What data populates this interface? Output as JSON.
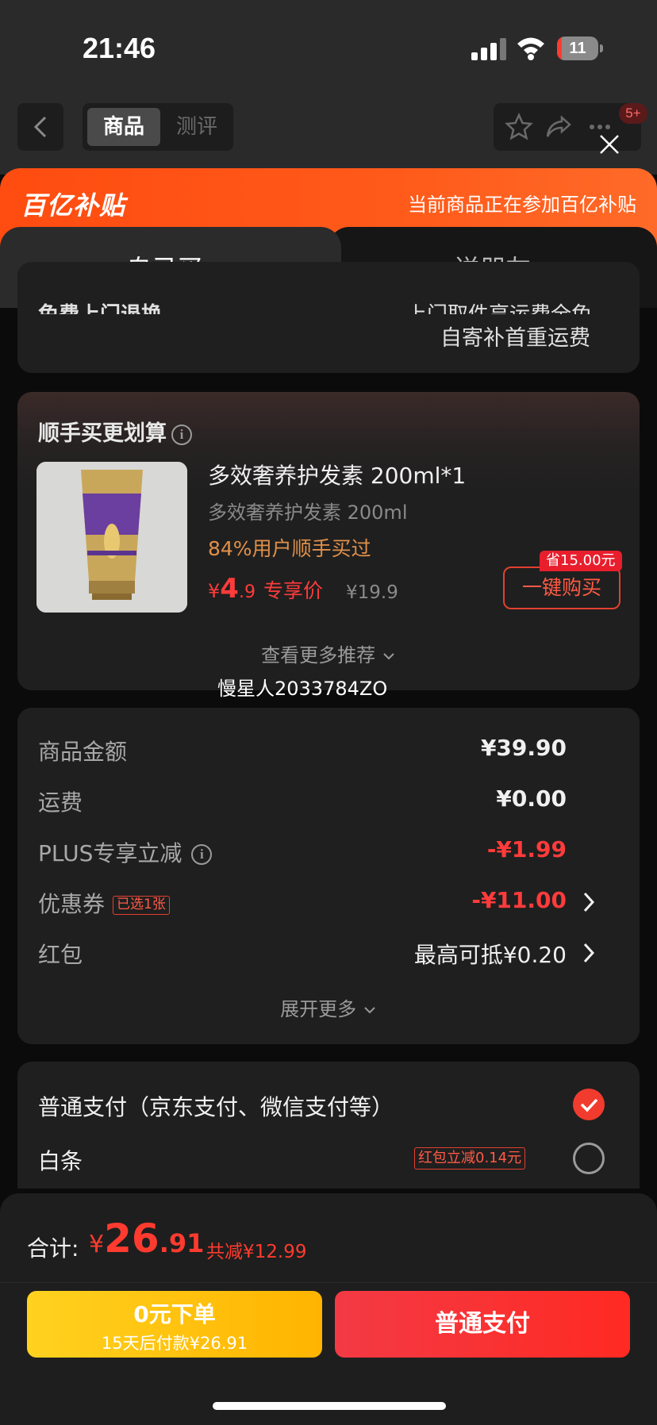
{
  "status_bar": {
    "time": "21:46",
    "battery": "11"
  },
  "header": {
    "tabs": [
      "商品",
      "测评"
    ],
    "badge": "5+"
  },
  "banner": {
    "logo": "百亿补贴",
    "note": "当前商品正在参加百亿补贴"
  },
  "buy_tabs": {
    "self": "自己买",
    "gift": "送朋友"
  },
  "return_card": {
    "left_partial": "免费上门退换",
    "right_partial": "上门取件享运费全免",
    "self_ship": "自寄补首重运费"
  },
  "addon": {
    "title": "顺手买更划算",
    "product_name": "多效奢养护发素 200ml*1",
    "spec": "多效奢养护发素 200ml",
    "bought": "84%用户顺手买过",
    "price_symbol": "¥",
    "price_int": "4",
    "price_dec": ".9",
    "price_tag": "专享价",
    "old_price": "¥19.9",
    "save_tag": "省15.00元",
    "buy_button": "一键购买",
    "more": "查看更多推荐"
  },
  "watermark": "慢星人2033784ZO",
  "costs": {
    "rows": [
      {
        "label": "商品金额",
        "value": "¥39.90"
      },
      {
        "label": "运费",
        "value": "¥0.00"
      },
      {
        "label": "PLUS专享立减",
        "value": "-¥1.99"
      },
      {
        "label": "优惠券",
        "tag": "已选1张",
        "value": "-¥11.00"
      },
      {
        "label": "红包",
        "value": "最高可抵¥0.20"
      }
    ],
    "expand": "展开更多"
  },
  "payment": {
    "normal": "普通支付（京东支付、微信支付等）",
    "baitiao": "白条",
    "baitiao_tag": "红包立减0.14元"
  },
  "total": {
    "label": "合计:",
    "symbol": "¥",
    "int": "26",
    "dec": ".91",
    "cut": "共减¥12.99"
  },
  "actions": {
    "zero_line1": "0元下单",
    "zero_line2": "15天后付款¥26.91",
    "pay": "普通支付"
  },
  "colors": {
    "accent": "#ff3b2f",
    "banner": "#ff5a1a",
    "yellow": "#ffc400"
  }
}
